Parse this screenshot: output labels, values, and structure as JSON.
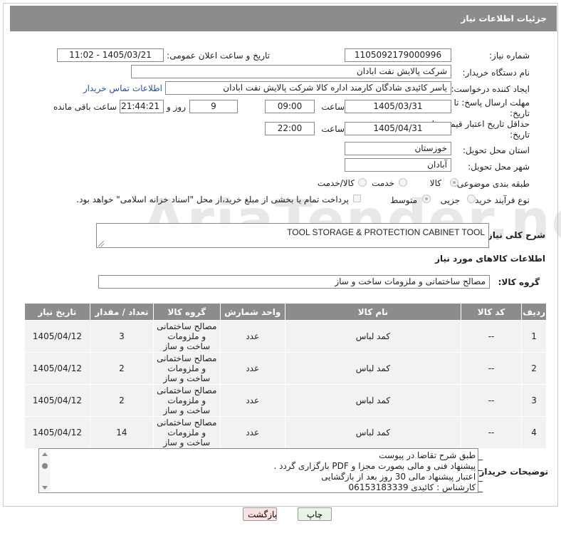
{
  "page_title": "جزئیات اطلاعات نیاز",
  "fields": {
    "need_number_label": "شماره نیاز:",
    "need_number": "1105092179000996",
    "announce_label": "تاریخ و ساعت اعلان عمومی:",
    "announce_value": "1405/03/21 - 11:02",
    "buyer_org_label": "نام دستگاه خریدار:",
    "buyer_org": "شرکت پالایش نفت ابادان",
    "creator_label": "ایجاد کننده درخواست:",
    "creator": "یاسر کائیدی شادگان کارمند اداره کالا شرکت پالایش نفت ابادان",
    "contact_link": "اطلاعات تماس خریدار",
    "reply_deadline_label": "مهلت ارسال پاسخ: تا تاریخ:",
    "reply_date": "1405/03/31",
    "time_label": "ساعت",
    "reply_time": "09:00",
    "days_value": "9",
    "days_label": "روز و",
    "remaining_time": "21:44:21",
    "remaining_label": "ساعت باقی مانده",
    "price_validity_label": "حداقل تاریخ اعتبار قیمت: تا تاریخ:",
    "price_date": "1405/04/31",
    "price_time": "22:00",
    "province_label": "استان محل تحویل:",
    "province": "خوزستان",
    "city_label": "شهر محل تحویل:",
    "city": "آبادان",
    "category_label": "طبقه بندی موضوعی:",
    "category_options": [
      "کالا",
      "خدمت",
      "کالا/خدمت"
    ],
    "category_selected": "کالا",
    "process_label": "نوع فرآیند خرید :",
    "process_options": [
      "جزیی",
      "متوسط"
    ],
    "process_selected": "متوسط",
    "payment_note": "پرداخت تمام یا بخشی از مبلغ خرید،از محل \"اسناد خزانه اسلامی\" خواهد بود."
  },
  "description": {
    "label": "شرح کلی نیاز:",
    "value": "TOOL STORAGE & PROTECTION CABINET TOOL"
  },
  "goods_info_title": "اطلاعات کالاهای مورد نیاز",
  "goods_group": {
    "label": "گروه کالا:",
    "value": "مصالح ساختمانی و ملزومات ساخت و ساز"
  },
  "table": {
    "headers": [
      "ردیف",
      "کد کالا",
      "نام کالا",
      "واحد شمارش",
      "گروه کالا",
      "تعداد / مقدار",
      "تاریخ نیاز"
    ],
    "rows": [
      {
        "row": "1",
        "code": "--",
        "name": "کمد لباس",
        "unit": "عدد",
        "group": "مصالح ساختمانی و ملزومات ساخت و ساز",
        "qty": "3",
        "date": "1405/04/12"
      },
      {
        "row": "2",
        "code": "--",
        "name": "کمد لباس",
        "unit": "عدد",
        "group": "مصالح ساختمانی و ملزومات ساخت و ساز",
        "qty": "2",
        "date": "1405/04/12"
      },
      {
        "row": "3",
        "code": "--",
        "name": "کمد لباس",
        "unit": "عدد",
        "group": "مصالح ساختمانی و ملزومات ساخت و ساز",
        "qty": "2",
        "date": "1405/04/12"
      },
      {
        "row": "4",
        "code": "--",
        "name": "کمد لباس",
        "unit": "عدد",
        "group": "مصالح ساختمانی و ملزومات ساخت و ساز",
        "qty": "14",
        "date": "1405/04/12"
      }
    ]
  },
  "buyer_notes": {
    "label": "توضیحات خریدار:",
    "lines": [
      "_ طبق شرح تقاضا در پیوست",
      "_ پیشنهاد فنی و مالی بصورت مجزا و PDF  بارگزاری گردد .",
      "_ اعتبار پیشنهاد مالی 30 روز بعد از بازگشایی",
      "_ کارشناس : کائیدی 06153183339"
    ]
  },
  "buttons": {
    "print": "چاپ",
    "back": "بازگشت"
  },
  "watermark": "AriaTender.neT"
}
